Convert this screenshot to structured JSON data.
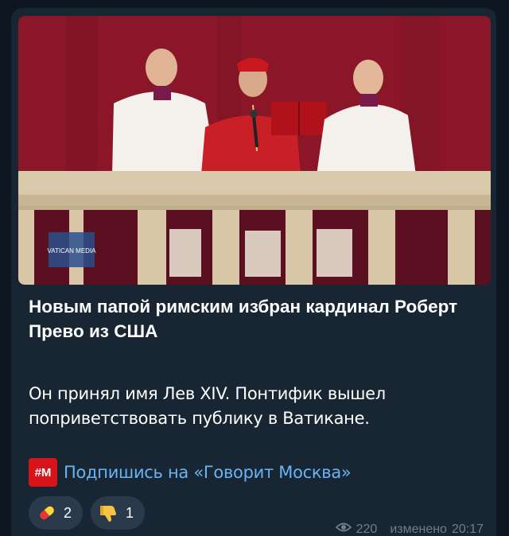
{
  "post": {
    "photo": {
      "alt": "",
      "watermark": "VATICAN MEDIA"
    },
    "title": "Новым папой римским избран кардинал Роберт Прево из США",
    "body": "Он принял имя Лев XIV. Понтифик вышел поприветствовать публику в Ватикане.",
    "channel_badge": "#M",
    "subscribe_link": "Подпишись на «Говорит Москва»",
    "reactions": [
      {
        "icon": "pill-icon",
        "count": "2"
      },
      {
        "icon": "thumbs-down-icon",
        "count": "1"
      }
    ],
    "views": "220",
    "edited_label": "изменено",
    "time": "20:17"
  },
  "colors": {
    "background": "#0e1621",
    "bubble": "#182533",
    "link": "#6ab3f3",
    "meta": "#6d7f8f",
    "reaction_bg": "#2b3a4b",
    "brand_red": "#d7141a"
  }
}
